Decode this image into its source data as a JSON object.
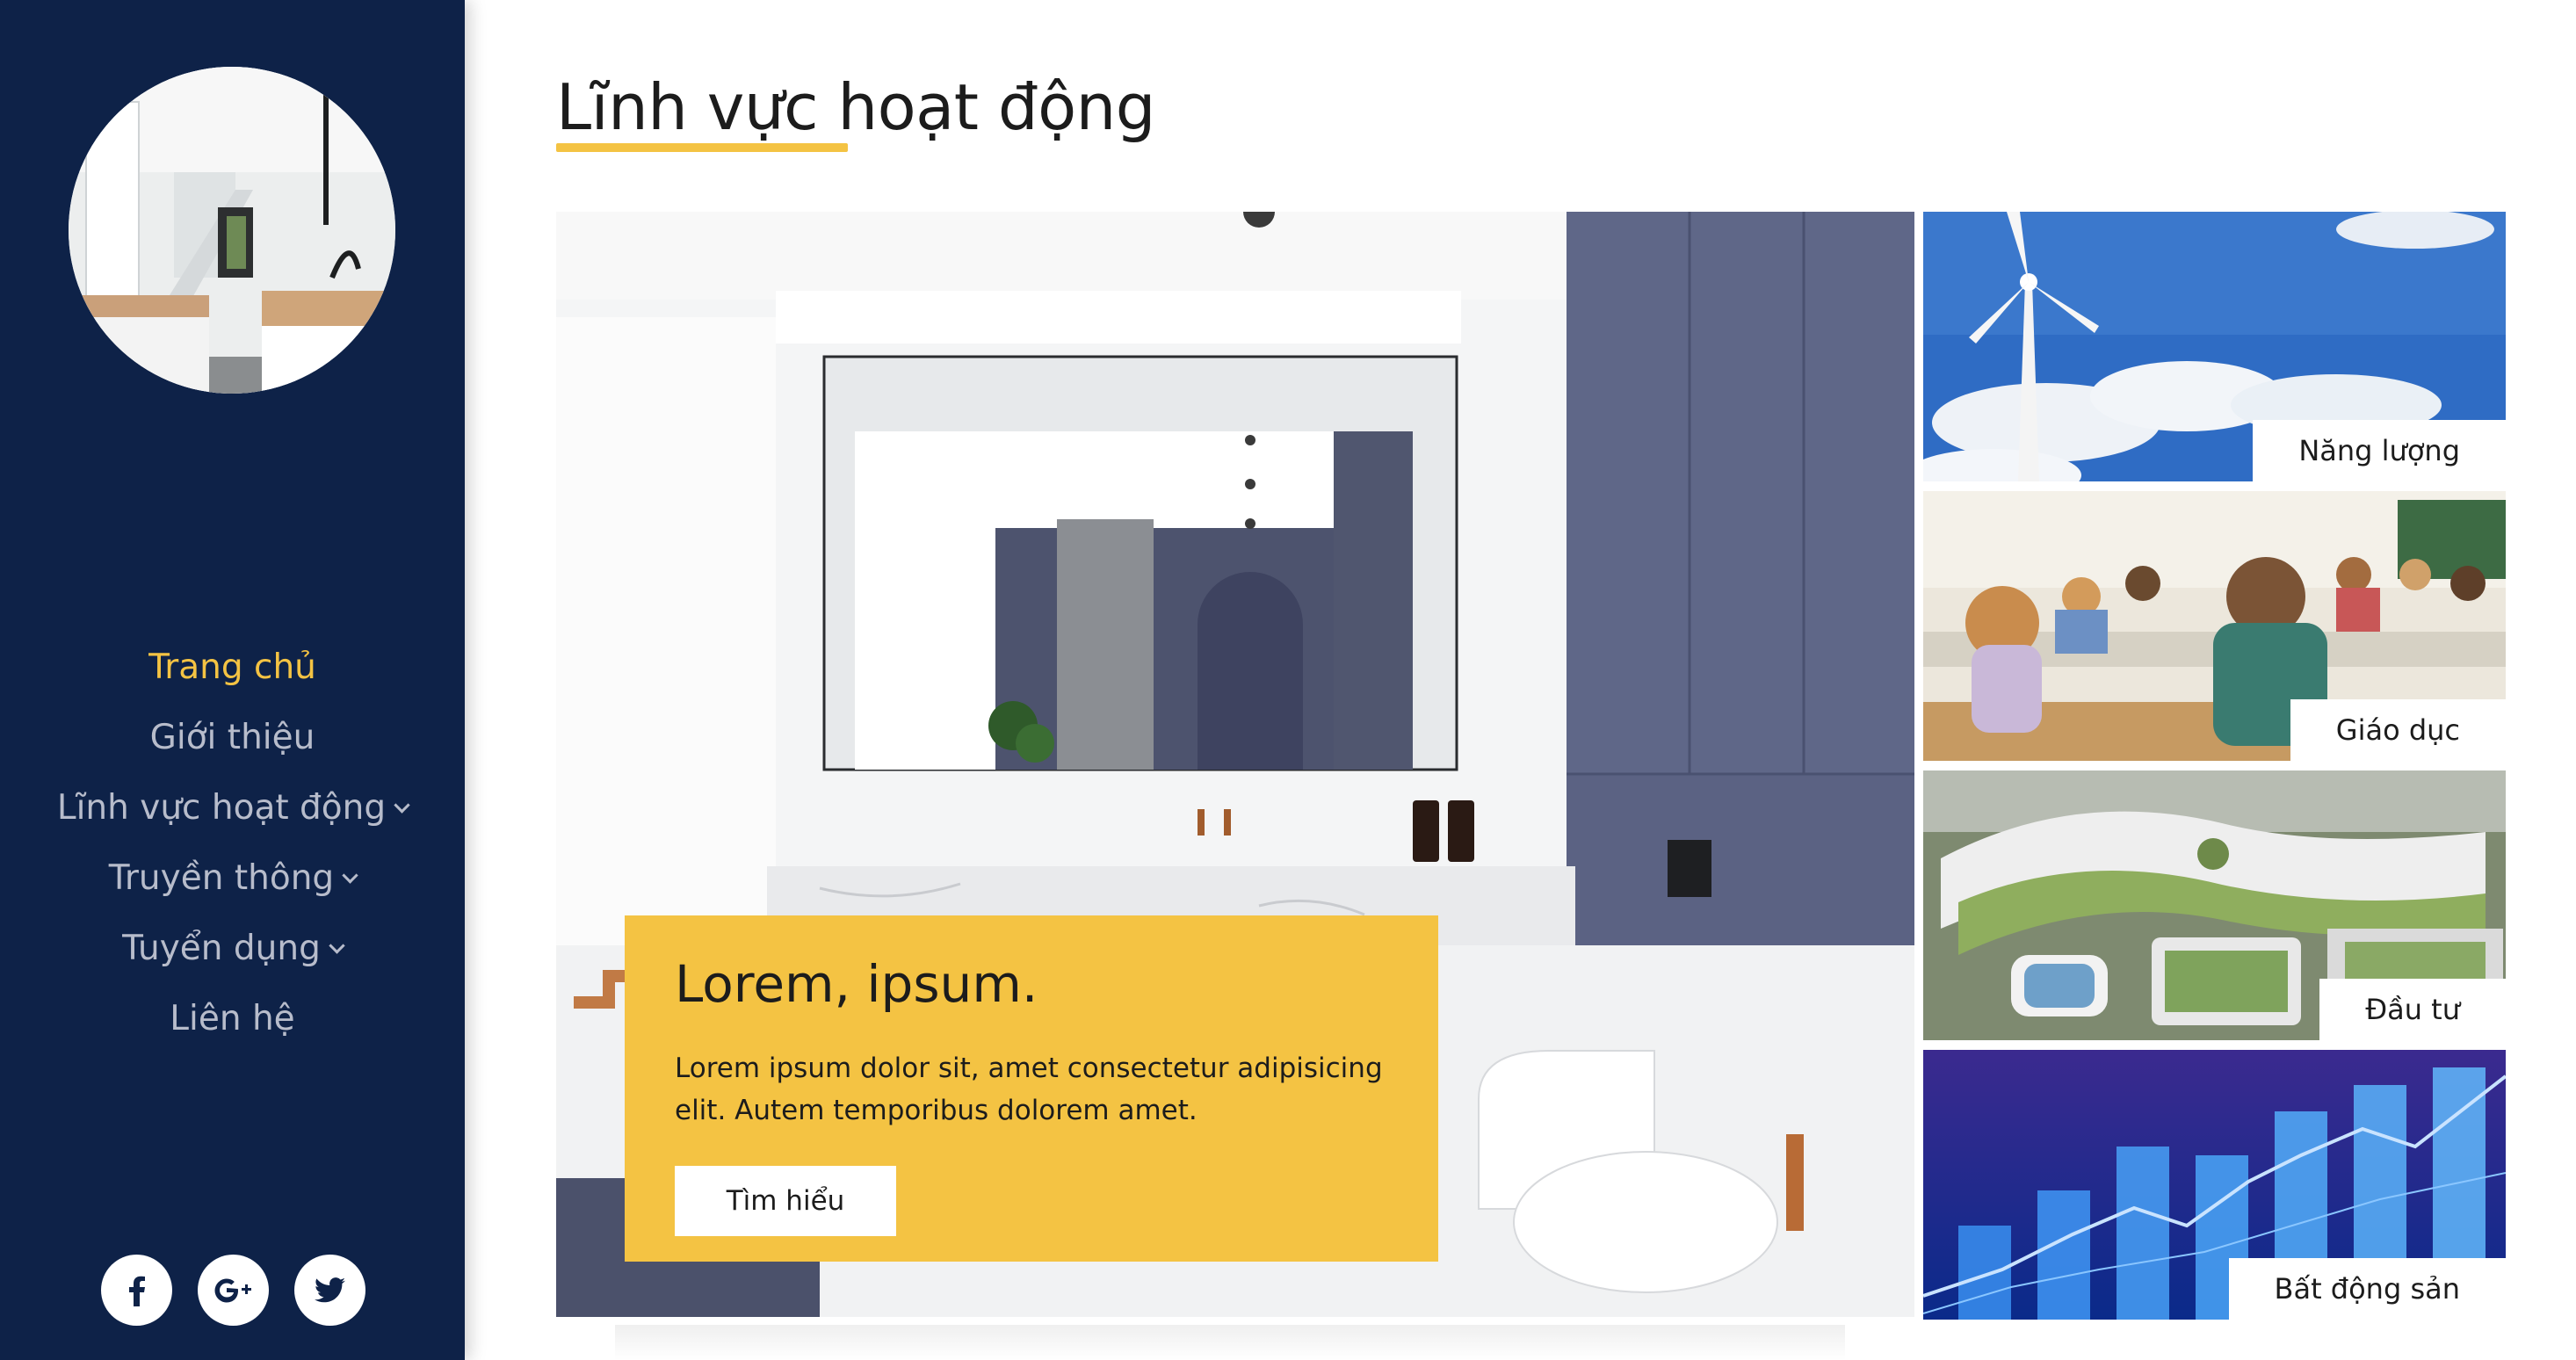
{
  "sidebar": {
    "nav": [
      {
        "label": "Trang chủ",
        "active": true,
        "dropdown": false
      },
      {
        "label": "Giới thiệu",
        "active": false,
        "dropdown": false
      },
      {
        "label": "Lĩnh vực hoạt động",
        "active": false,
        "dropdown": true
      },
      {
        "label": "Truyền thông",
        "active": false,
        "dropdown": true
      },
      {
        "label": "Tuyển dụng",
        "active": false,
        "dropdown": true
      },
      {
        "label": "Liên hệ",
        "active": false,
        "dropdown": false
      }
    ],
    "social": [
      "facebook-icon",
      "google-plus-icon",
      "twitter-icon"
    ]
  },
  "main": {
    "title": "Lĩnh vực hoạt động",
    "hero": {
      "heading": "Lorem, ipsum.",
      "text": "Lorem ipsum dolor sit, amet consectetur adipisicing elit. Autem temporibus dolorem amet.",
      "button": "Tìm hiểu"
    },
    "tiles": [
      {
        "label": "Năng lượng"
      },
      {
        "label": "Giáo dục"
      },
      {
        "label": "Đầu tư"
      },
      {
        "label": "Bất động sản"
      }
    ]
  },
  "colors": {
    "sidebar_bg": "#0e2248",
    "accent": "#f4c343",
    "nav_text": "#b7bccb"
  }
}
